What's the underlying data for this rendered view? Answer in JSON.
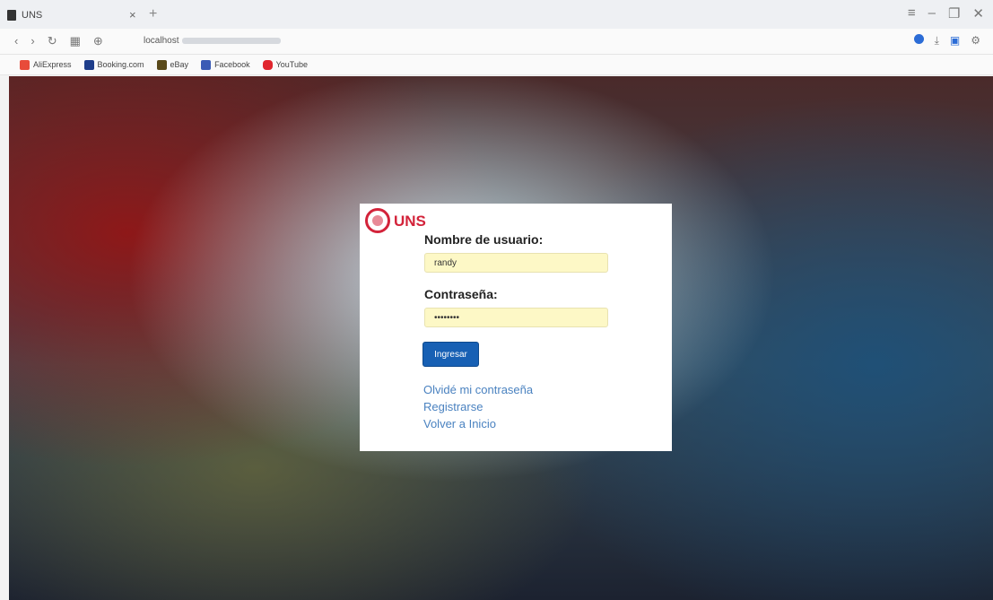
{
  "browser": {
    "tab_title": "UNS",
    "url_host": "localhost",
    "bookmarks": [
      "AliExpress",
      "Booking.com",
      "eBay",
      "Facebook",
      "YouTube"
    ]
  },
  "login": {
    "brand": "UNS",
    "username_label": "Nombre de usuario:",
    "username_value": "randy",
    "password_label": "Contraseña:",
    "password_value": "••••••••",
    "submit_label": "Ingresar",
    "links": [
      "Olvidé mi contraseña",
      "Registrarse",
      "Volver a Inicio"
    ]
  },
  "colors": {
    "brand_red": "#d3233a",
    "button_blue": "#1760b4",
    "autofill_yellow": "#fdf8c6",
    "link_blue": "#4a82c0"
  },
  "icons": {
    "window_controls": [
      "minimize-icon",
      "restore-icon",
      "close-icon"
    ],
    "nav": [
      "back-icon",
      "forward-icon",
      "reload-icon",
      "apps-icon"
    ]
  }
}
